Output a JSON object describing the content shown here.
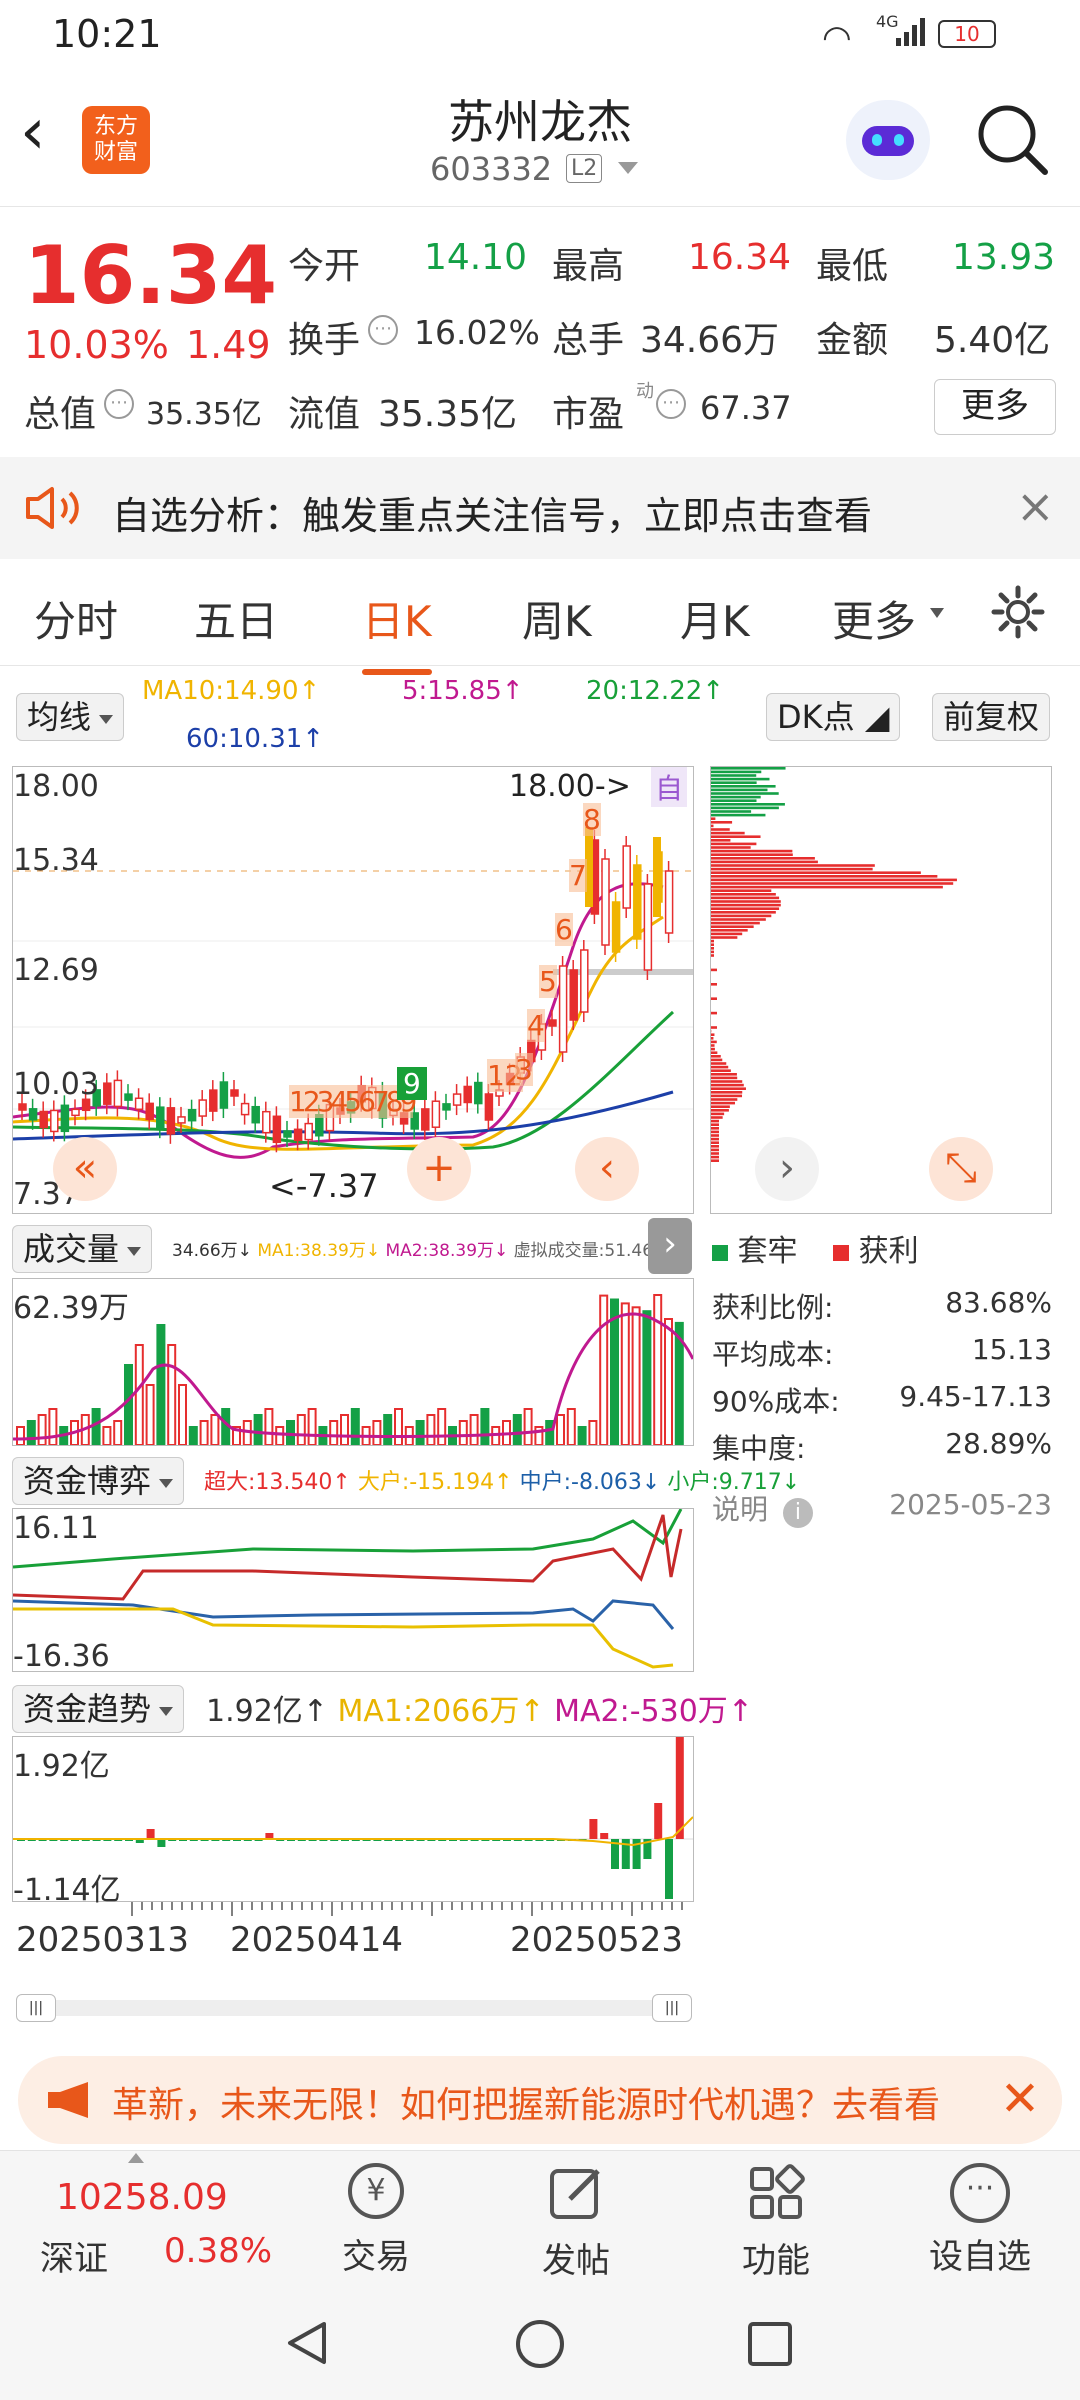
{
  "status_bar": {
    "time": "10:21",
    "network": "4G",
    "battery": "10"
  },
  "header": {
    "app_logo_line1": "东方",
    "app_logo_line2": "财富",
    "stock_name": "苏州龙杰",
    "stock_code": "603332",
    "level_badge": "L2"
  },
  "quote": {
    "price": "16.34",
    "change_pct": "10.03%",
    "change": "1.49",
    "open_label": "今开",
    "open": "14.10",
    "high_label": "最高",
    "high": "16.34",
    "low_label": "最低",
    "low": "13.93",
    "turnover_label": "换手",
    "turnover": "16.02%",
    "volume_label": "总手",
    "volume": "34.66万",
    "amount_label": "金额",
    "amount": "5.40亿",
    "mktcap_label": "总值",
    "mktcap": "35.35亿",
    "float_label": "流值",
    "float_cap": "35.35亿",
    "pe_label": "市盈",
    "pe_sup": "动",
    "pe": "67.37",
    "more": "更多"
  },
  "alert": {
    "text": "自选分析：触发重点关注信号，立即点击查看"
  },
  "tabs": [
    "分时",
    "五日",
    "日K",
    "周K",
    "月K",
    "更多"
  ],
  "active_tab": "日K",
  "ma": {
    "selector": "均线",
    "ma10": "MA10:14.90↑",
    "ma5": "5:15.85↑",
    "ma20": "20:12.22↑",
    "ma60": "60:10.31↑",
    "dk": "DK点",
    "adjust": "前复权"
  },
  "kline": {
    "y_labels": [
      "18.00",
      "15.34",
      "12.69",
      "10.03",
      "7.37"
    ],
    "high_marker": "18.00->",
    "low_marker": "<-7.37",
    "auto_tag": "自",
    "seq_left": "123456789",
    "seq_right": [
      "1",
      "2",
      "3",
      "4",
      "5",
      "6",
      "7",
      "8",
      "9"
    ]
  },
  "volume": {
    "selector": "成交量",
    "info": "34.66万↓ MA1:38.39万↓ MA2:38.39万↓ 虚拟成交量:51.46万",
    "info_vol": "34.66万↓",
    "info_ma1": "MA1:38.39万↓",
    "info_ma2": "MA2:38.39万↓",
    "info_virtual": "虚拟成交量:51.46万",
    "max_label": "62.39万"
  },
  "fund_game": {
    "selector": "资金博弈",
    "super": "超大:13.540↑",
    "large": "大户:-15.194↑",
    "medium": "中户:-8.063↓",
    "small": "小户:9.717↓",
    "top_label": "16.11",
    "bottom_label": "-16.36"
  },
  "fund_trend": {
    "selector": "资金趋势",
    "value": "1.92亿↑",
    "ma1": "MA1:2066万↑",
    "ma2": "MA2:-530万↑",
    "top_label": "1.92亿",
    "bottom_label": "-1.14亿"
  },
  "dates": [
    "20250313",
    "20250414",
    "20250523"
  ],
  "chip": {
    "legend_trapped": "套牢",
    "legend_profit": "获利",
    "rows": [
      {
        "label": "获利比例:",
        "value": "83.68%"
      },
      {
        "label": "平均成本:",
        "value": "15.13"
      },
      {
        "label": "90%成本:",
        "value": "9.45-17.13"
      },
      {
        "label": "集中度:",
        "value": "28.89%"
      }
    ],
    "note": "说明",
    "date": "2025-05-23"
  },
  "banner": {
    "text": "革新，未来无限！如何把握新能源时代机遇？去看看"
  },
  "bottom_nav": {
    "index_value": "10258.09",
    "index_name": "深证",
    "index_pct": "0.38%",
    "trade": "交易",
    "post": "发帖",
    "func": "功能",
    "watch": "设自选"
  },
  "colors": {
    "up": "#e62e2e",
    "down": "#14a046",
    "accent": "#e8571a",
    "ma5": "#c0198f",
    "ma10": "#f0b400",
    "ma20": "#18a038",
    "ma60": "#1c3fa8"
  }
}
